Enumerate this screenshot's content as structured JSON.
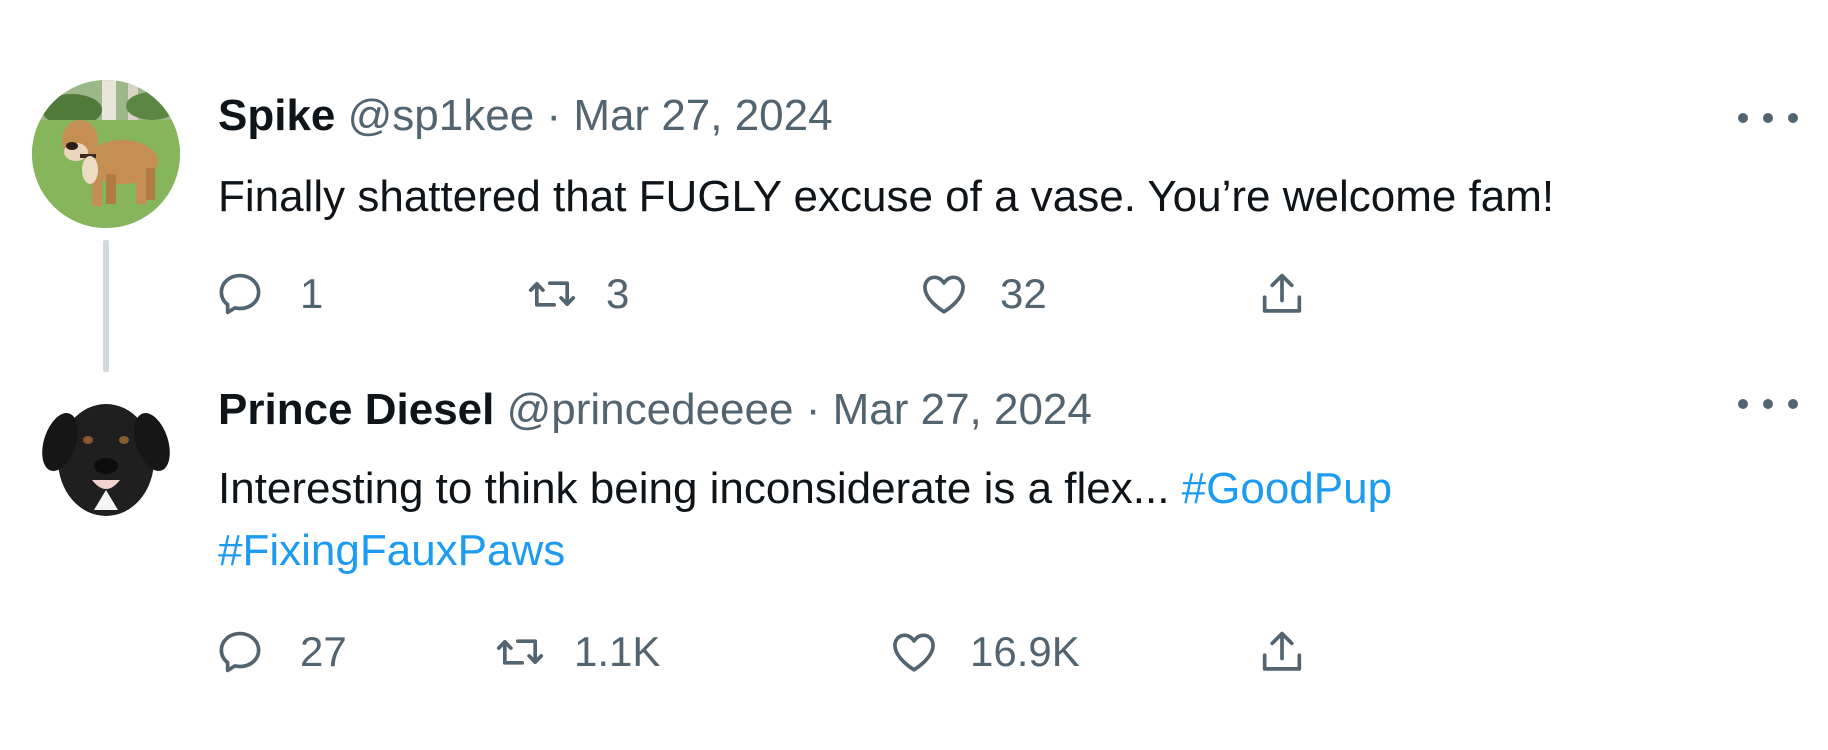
{
  "tweets": [
    {
      "name": "Spike",
      "handle": "@sp1kee",
      "separator": "·",
      "date": "Mar 27, 2024",
      "text": "Finally shattered that FUGLY excuse of a vase. You’re welcome fam!",
      "avatar_icon": "bulldog-avatar",
      "stats": {
        "replies": "1",
        "retweets": "3",
        "likes": "32"
      }
    },
    {
      "name": "Prince Diesel",
      "handle": "@princedeeee",
      "separator": "·",
      "date": "Mar 27, 2024",
      "text": "Interesting to think being inconsiderate is a flex...",
      "hashtags": [
        "#GoodPup",
        "#FixingFauxPaws"
      ],
      "avatar_icon": "black-lab-avatar",
      "stats": {
        "replies": "27",
        "retweets": "1.1K",
        "likes": "16.9K"
      }
    }
  ],
  "colors": {
    "text": "#0f1419",
    "secondary": "#536471",
    "link": "#1d9bf0",
    "thread_line": "#cfd9de"
  },
  "icons": [
    "reply-icon",
    "retweet-icon",
    "like-icon",
    "share-icon",
    "more-icon"
  ]
}
